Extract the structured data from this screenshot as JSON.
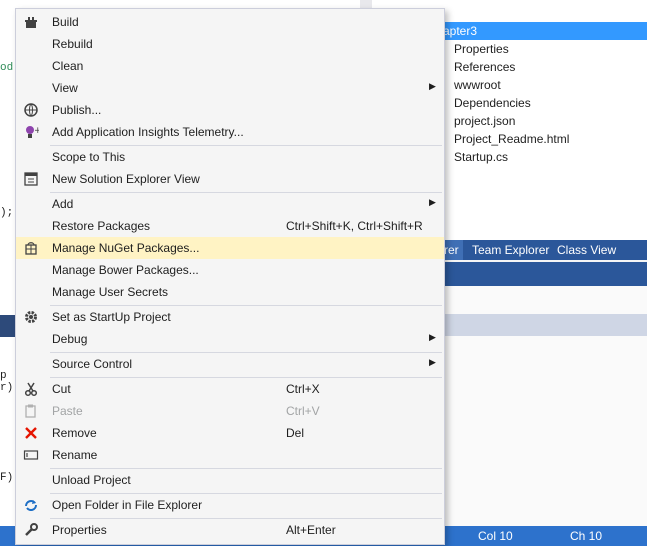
{
  "background": {
    "code_fragments": [
      "od",
      ");",
      "p",
      "r)",
      "F)"
    ],
    "solution_explorer": {
      "selected_item": "apter3",
      "items": [
        "Properties",
        "References",
        "wwwroot",
        "Dependencies",
        "project.json",
        "Project_Readme.html",
        "Startup.cs"
      ]
    },
    "tabs": [
      "rer",
      "Team Explorer",
      "Class View"
    ],
    "status_bar": {
      "col": "Col 10",
      "ch": "Ch 10"
    }
  },
  "menu": {
    "items": [
      {
        "label": "Build",
        "icon": "build-icon"
      },
      {
        "label": "Rebuild"
      },
      {
        "label": "Clean"
      },
      {
        "label": "View",
        "submenu": true
      },
      {
        "label": "Publish...",
        "icon": "publish-icon"
      },
      {
        "label": "Add Application Insights Telemetry...",
        "icon": "insights-icon"
      },
      {
        "label": "Scope to This"
      },
      {
        "label": "New Solution Explorer View",
        "icon": "new-view-icon"
      },
      {
        "label": "Add",
        "submenu": true
      },
      {
        "label": "Restore Packages",
        "shortcut": "Ctrl+Shift+K, Ctrl+Shift+R"
      },
      {
        "label": "Manage NuGet Packages...",
        "icon": "nuget-icon",
        "highlighted": true
      },
      {
        "label": "Manage Bower Packages..."
      },
      {
        "label": "Manage User Secrets"
      },
      {
        "label": "Set as StartUp Project",
        "icon": "gear-icon"
      },
      {
        "label": "Debug",
        "submenu": true
      },
      {
        "label": "Source Control",
        "submenu": true
      },
      {
        "label": "Cut",
        "icon": "cut-icon",
        "shortcut": "Ctrl+X"
      },
      {
        "label": "Paste",
        "icon": "paste-icon",
        "shortcut": "Ctrl+V",
        "disabled": true
      },
      {
        "label": "Remove",
        "icon": "remove-icon",
        "shortcut": "Del"
      },
      {
        "label": "Rename",
        "icon": "rename-icon"
      },
      {
        "label": "Unload Project"
      },
      {
        "label": "Open Folder in File Explorer",
        "icon": "open-folder-icon"
      },
      {
        "label": "Properties",
        "icon": "wrench-icon",
        "shortcut": "Alt+Enter"
      }
    ]
  },
  "colors": {
    "highlight": "#fff3c4",
    "accent": "#3399ff",
    "status_bar": "#2d72cc",
    "remove_icon": "#e51400"
  }
}
